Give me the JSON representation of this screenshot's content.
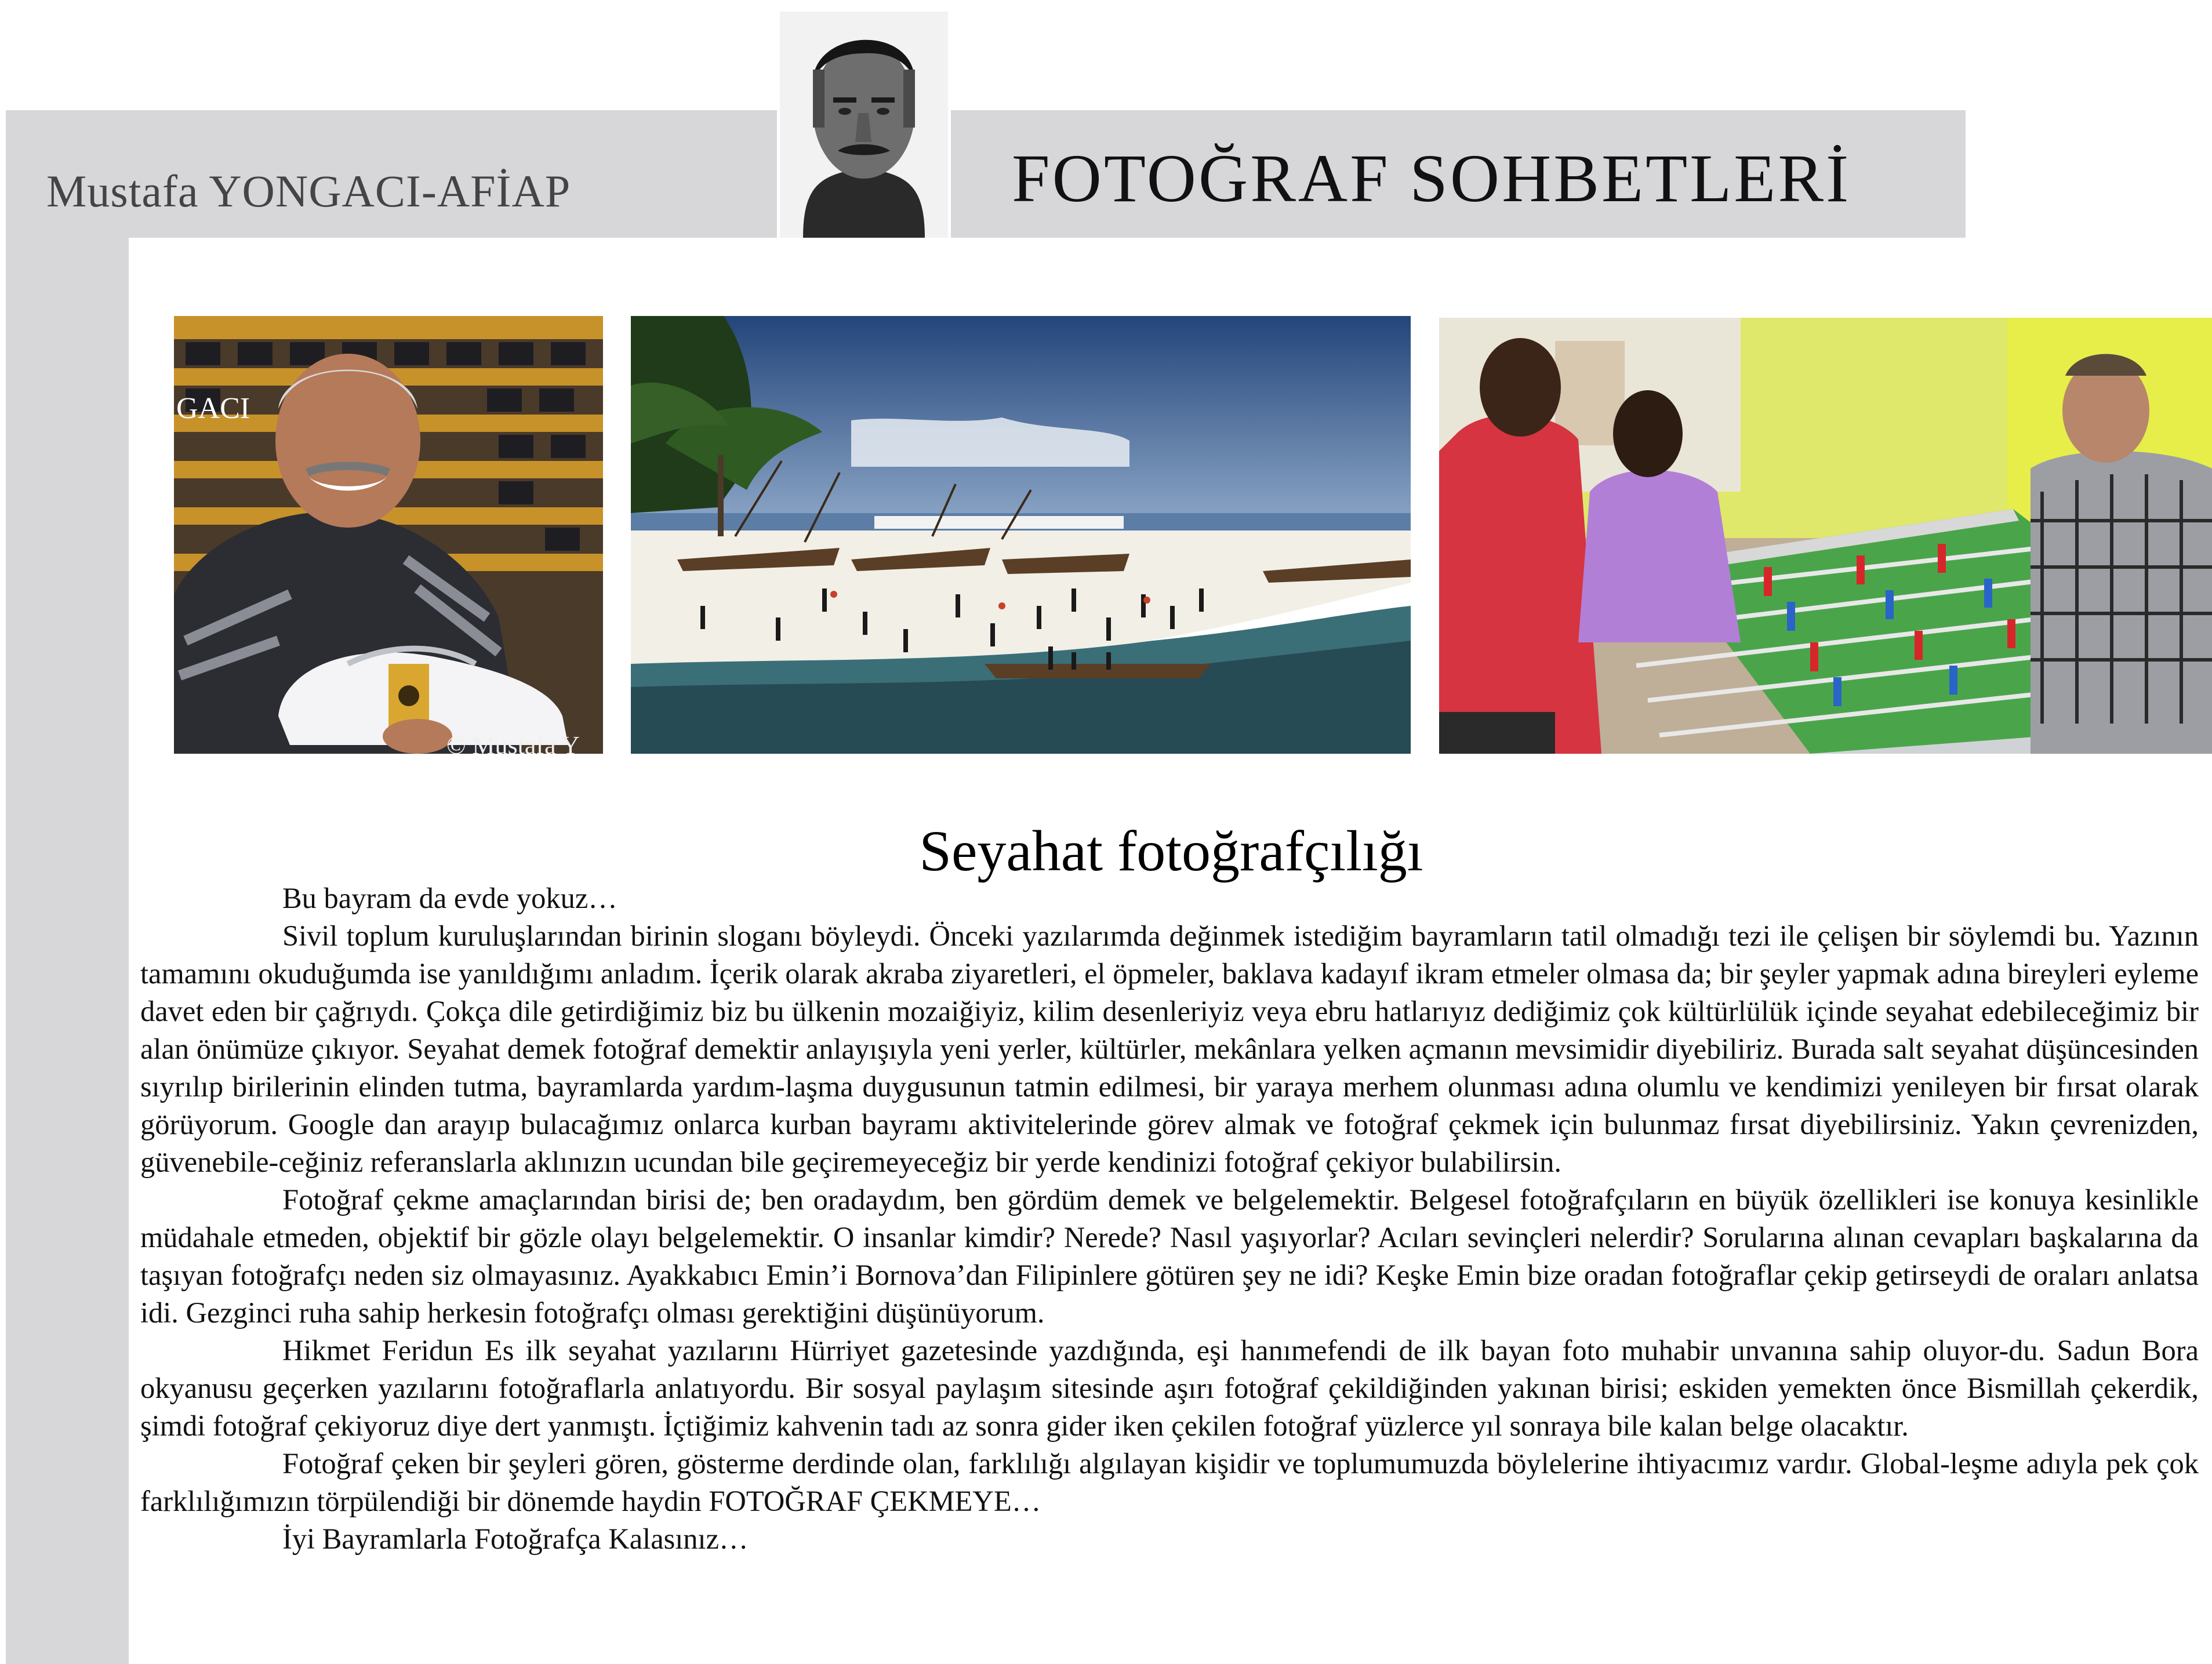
{
  "header": {
    "author": "Mustafa YONGACI-AFİAP",
    "column_title": "FOTOĞRAF SOHBETLERİ",
    "author_photo_icon": "author-portrait"
  },
  "photos": {
    "shoe_seller": {
      "label": "GACI",
      "copyright": "© Mustafa Y"
    },
    "beach": {},
    "foosball": {}
  },
  "article": {
    "title": "Seyahat fotoğrafçılığı",
    "p1": "Bu bayram da evde yokuz…",
    "p2": "Sivil toplum kuruluşlarından birinin sloganı böyleydi. Önceki yazılarımda değinmek istediğim bayramların tatil olmadığı tezi ile çelişen bir söylemdi bu. Yazının tamamını okuduğumda ise yanıldığımı anladım. İçerik olarak akraba ziyaretleri, el öpmeler, baklava kadayıf ikram etmeler olmasa da; bir şeyler yapmak adına bireyleri eyleme davet eden bir çağrıydı. Çokça dile getirdiğimiz biz bu ülkenin mozaiğiyiz, kilim desenleriyiz veya ebru hatlarıyız dediğimiz çok kültürlülük içinde seyahat edebileceğimiz bir alan önümüze çıkıyor. Seyahat demek fotoğraf demektir anlayışıyla yeni yerler, kültürler, mekânlara yelken açmanın mevsimidir diyebiliriz. Burada salt seyahat düşüncesinden sıyrılıp birilerinin elinden tutma, bayramlarda yardım-laşma duygusunun tatmin edilmesi, bir yaraya merhem olunması adına olumlu ve kendimizi yenileyen bir fırsat olarak görüyorum. Google dan arayıp bulacağımız onlarca kurban bayramı aktivitelerinde görev almak ve fotoğraf çekmek için bulunmaz fırsat diyebilirsiniz. Yakın çevrenizden, güvenebile-ceğiniz referanslarla aklınızın ucundan bile geçiremeyeceğiz bir yerde kendinizi fotoğraf çekiyor bulabilirsin.",
    "p3": "Fotoğraf çekme amaçlarından birisi de; ben oradaydım, ben gördüm demek ve belgelemektir. Belgesel fotoğrafçıların en büyük özellikleri ise konuya kesinlikle müdahale etmeden, objektif bir gözle olayı belgelemektir. O insanlar kimdir? Nerede? Nasıl yaşıyorlar? Acıları sevinçleri nelerdir? Sorularına alınan cevapları başkalarına da taşıyan fotoğrafçı neden siz olmayasınız. Ayakkabıcı Emin’i Bornova’dan Filipinlere götüren şey ne idi? Keşke Emin bize oradan fotoğraflar çekip getirseydi de oraları anlatsa idi. Gezginci ruha sahip herkesin fotoğrafçı olması gerektiğini düşünüyorum.",
    "p4": "Hikmet Feridun Es ilk seyahat yazılarını Hürriyet gazetesinde yazdığında, eşi hanımefendi de ilk bayan foto muhabir unvanına sahip oluyor-du. Sadun Bora okyanusu geçerken yazılarını fotoğraflarla anlatıyordu. Bir sosyal paylaşım sitesinde aşırı fotoğraf çekildiğinden yakınan birisi; eskiden yemekten önce Bismillah çekerdik, şimdi fotoğraf çekiyoruz diye dert yanmıştı. İçtiğimiz kahvenin tadı az sonra gider iken çekilen fotoğraf yüzlerce yıl sonraya bile kalan belge olacaktır.",
    "p5": "Fotoğraf çeken bir şeyleri gören, gösterme derdinde olan, farklılığı algılayan kişidir ve toplumumuzda böylelerine ihtiyacımız vardır. Global-leşme adıyla pek çok farklılığımızın törpülendiği bir dönemde haydin FOTOĞRAF ÇEKMEYE…",
    "p6": "İyi Bayramlarla Fotoğrafça Kalasınız…"
  }
}
